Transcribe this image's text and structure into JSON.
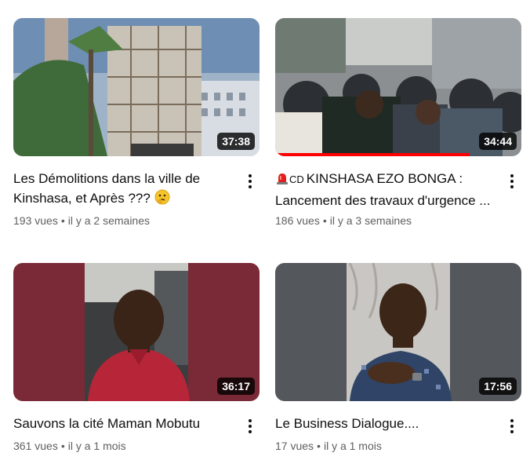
{
  "videos": [
    {
      "title_line1": "Les Démolitions dans la ville de",
      "title_line2": "Kinshasa, et Après ???",
      "views": "193 vues",
      "age": "il y a 2 semaines",
      "duration": "37:38",
      "watched_fraction": 0,
      "title_emoji": "thinking-face-icon"
    },
    {
      "title_prefix_icon": "red-siren-icon",
      "title_flag": "CD",
      "title_line1": "KINSHASA EZO BONGA :",
      "title_line2": "Lancement des travaux d'urgence ...",
      "views": "186 vues",
      "age": "il y a 3 semaines",
      "duration": "34:44",
      "watched_fraction": 0.79
    },
    {
      "title_line1": "Sauvons la cité Maman Mobutu",
      "title_line2": "",
      "views": "361 vues",
      "age": "il y a 1 mois",
      "duration": "36:17",
      "watched_fraction": 0
    },
    {
      "title_line1": "Le Business Dialogue....",
      "title_line2": "",
      "views": "17 vues",
      "age": "il y a 1 mois",
      "duration": "17:56",
      "watched_fraction": 0
    }
  ],
  "separator": "•",
  "colors": {
    "progress": "#ff0000",
    "meta_text": "#606060",
    "title_text": "#0f0f0f"
  }
}
